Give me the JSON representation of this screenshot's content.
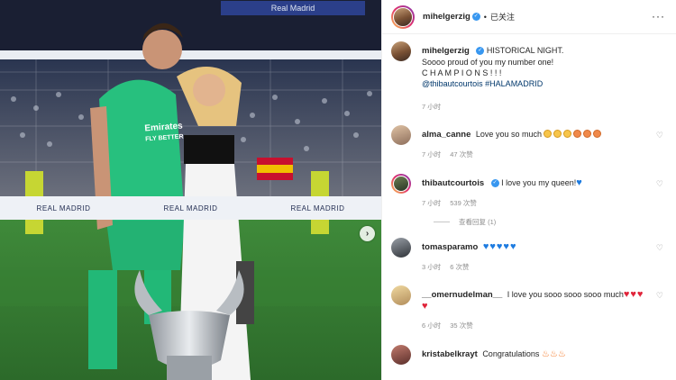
{
  "photo": {
    "stadium_sign": "Real Madrid",
    "jersey_text": [
      "Emirates",
      "FLY BETTER"
    ],
    "board_text": [
      "REAL MADRID",
      "REAL MADRID",
      "REAL MADRID"
    ],
    "carousel_next": "›"
  },
  "post": {
    "author": "mihelgerzig",
    "follow_label": "已关注",
    "caption_lines": [
      "HISTORICAL NIGHT.",
      "Soooo proud of you my number one!",
      "C H A M P I O N S ! ! !"
    ],
    "caption_links": "@thibautcourtois #HALAMADRID",
    "caption_time": "7 小时"
  },
  "comments": [
    {
      "user": "alma_canne",
      "text": "Love you so much",
      "emoji": "face-x6",
      "time": "7 小时",
      "likes": "47 次赞"
    },
    {
      "user": "thibautcourtois",
      "text": "I love you my queen!",
      "emoji": "blue-heart",
      "time": "7 小时",
      "likes": "539 次赞",
      "replies": "查看回复 (1)"
    },
    {
      "user": "tomasparamo",
      "text": "",
      "emoji": "blue-heart-x5",
      "time": "3 小时",
      "likes": "6 次赞"
    },
    {
      "user": "__omernudelman__",
      "text": "I love you sooo sooo sooo much",
      "emoji": "red-heart-x4",
      "time": "6 小时",
      "likes": "35 次赞"
    },
    {
      "user": "kristabelkrayt",
      "text": "Congratulations",
      "emoji": "fire-x3"
    }
  ],
  "icons": [
    "verified-badge-icon",
    "more-options-icon",
    "heart-icon",
    "chevron-right-icon"
  ],
  "colors": {
    "link": "#00376b",
    "verified": "#3897f0",
    "meta": "#8e8e8e"
  }
}
